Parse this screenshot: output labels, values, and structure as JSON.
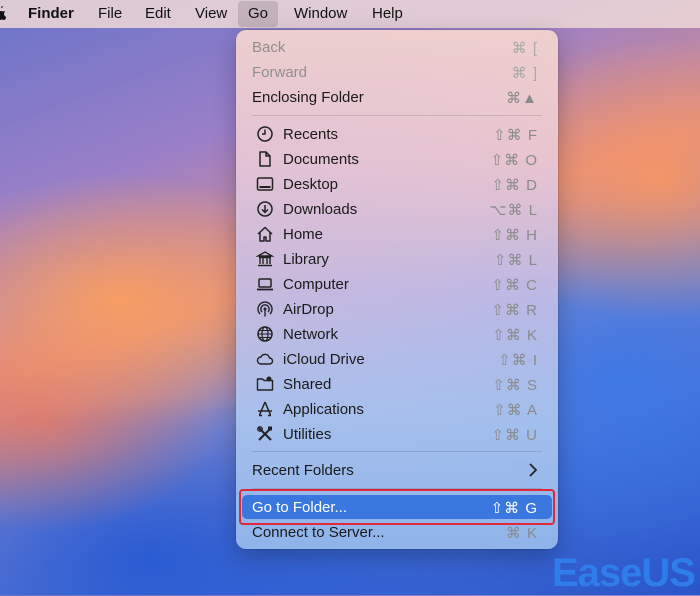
{
  "menubar": {
    "items": [
      {
        "label": "Finder"
      },
      {
        "label": "File"
      },
      {
        "label": "Edit"
      },
      {
        "label": "View"
      },
      {
        "label": "Go"
      },
      {
        "label": "Window"
      },
      {
        "label": "Help"
      }
    ]
  },
  "go_menu": {
    "items": [
      {
        "label": "Back",
        "shortcut": "⌘ [",
        "state": "disabled"
      },
      {
        "label": "Forward",
        "shortcut": "⌘ ]",
        "state": "disabled"
      },
      {
        "label": "Enclosing Folder",
        "shortcut": "⌘▲"
      },
      {
        "label": "Recents",
        "shortcut": "⇧⌘ F",
        "icon": "clock-icon"
      },
      {
        "label": "Documents",
        "shortcut": "⇧⌘ O",
        "icon": "document-icon"
      },
      {
        "label": "Desktop",
        "shortcut": "⇧⌘ D",
        "icon": "desktop-icon"
      },
      {
        "label": "Downloads",
        "shortcut": "⌥⌘ L",
        "icon": "download-icon"
      },
      {
        "label": "Home",
        "shortcut": "⇧⌘ H",
        "icon": "home-icon"
      },
      {
        "label": "Library",
        "shortcut": "⇧⌘ L",
        "icon": "library-icon"
      },
      {
        "label": "Computer",
        "shortcut": "⇧⌘ C",
        "icon": "laptop-icon"
      },
      {
        "label": "AirDrop",
        "shortcut": "⇧⌘ R",
        "icon": "airdrop-icon"
      },
      {
        "label": "Network",
        "shortcut": "⇧⌘ K",
        "icon": "globe-icon"
      },
      {
        "label": "iCloud Drive",
        "shortcut": "⇧⌘ I",
        "icon": "cloud-icon"
      },
      {
        "label": "Shared",
        "shortcut": "⇧⌘ S",
        "icon": "shared-folder-icon"
      },
      {
        "label": "Applications",
        "shortcut": "⇧⌘ A",
        "icon": "applications-icon"
      },
      {
        "label": "Utilities",
        "shortcut": "⇧⌘ U",
        "icon": "tools-icon"
      },
      {
        "label": "Recent Folders",
        "submenu": true
      },
      {
        "label": "Go to Folder...",
        "shortcut": "⇧⌘ G",
        "state": "highlighted"
      },
      {
        "label": "Connect to Server...",
        "shortcut": "⌘ K"
      }
    ]
  },
  "watermark": {
    "text": "EaseUS"
  },
  "colors": {
    "highlight": "#3a78e0",
    "annotation_box": "#e0283a",
    "watermark": "#2f7dea"
  }
}
